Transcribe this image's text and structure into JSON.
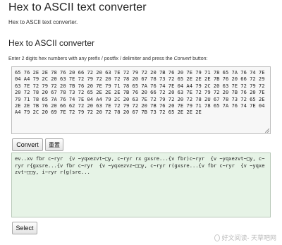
{
  "header": {
    "title": "Hex to ASCII text converter",
    "subtitle": "Hex to ASCII text converter."
  },
  "converter": {
    "section_title": "Hex to ASCII converter",
    "instructions_prefix": "Enter 2 digits hex numbers with any prefix / postfix / delimiter and press the ",
    "instructions_emph": "Convert",
    "instructions_suffix": " button:",
    "hex_input_value": "65 76 2E 2E 78 76 20 66 72 20 63 7E 72 79 72 20 7B 76 20 7E 79 71 78 65 7A 76 74 7E 04 A4 79 2C 20 63 7E 72 79 72 20 72 78 20 67 78 73 72 65 2E 2E 2E 7B 76 20 66 72 29 63 7E 72 79 72 20 7B 76 20 7E 79 71 78 65 7A 76 74 7E 04 A4 79 2C 20 63 7E 72 79 72 20 72 78 20 67 78 73 72 65 2E 2E 2E 7B 76 20 66 72 20 63 7E 72 79 72 20 7B 76 20 7E 79 71 78 65 7A 76 74 7E 04 A4 79 2C 20 63 7E 72 79 72 20 72 78 2U 67 78 73 72 65 2E 2E 2E 7B 76 20 66 62 72 20 63 7E 72 79 72 20 7B 76 20 7E 79 71 78 65 7A 76 74 7E 04 A4 79 2C 20 69 7E 72 79 72 20 72 78 20 67 7B 73 72 65 2E 2E 2E",
    "convert_label": "Convert",
    "reset_label": "重置",
    "ascii_output_value": "ev..xv fbr c~ryr  {v ~yqxezvt~□y, c~ryr rx gxsre...{v fbr)c~ryr  {v ~yqxezvt~□y, c~ryr r{gxsre...{v fbr c~ryr  {v ~yqxezvz~□□y, c~ryr r(gxsre...{v fbr c~ryr  {v ~yqxezvt~□□y, i~ryr r(g(sre...",
    "select_label": "Select"
  },
  "watermark": {
    "text": "好文阅读- 天草吧网"
  }
}
